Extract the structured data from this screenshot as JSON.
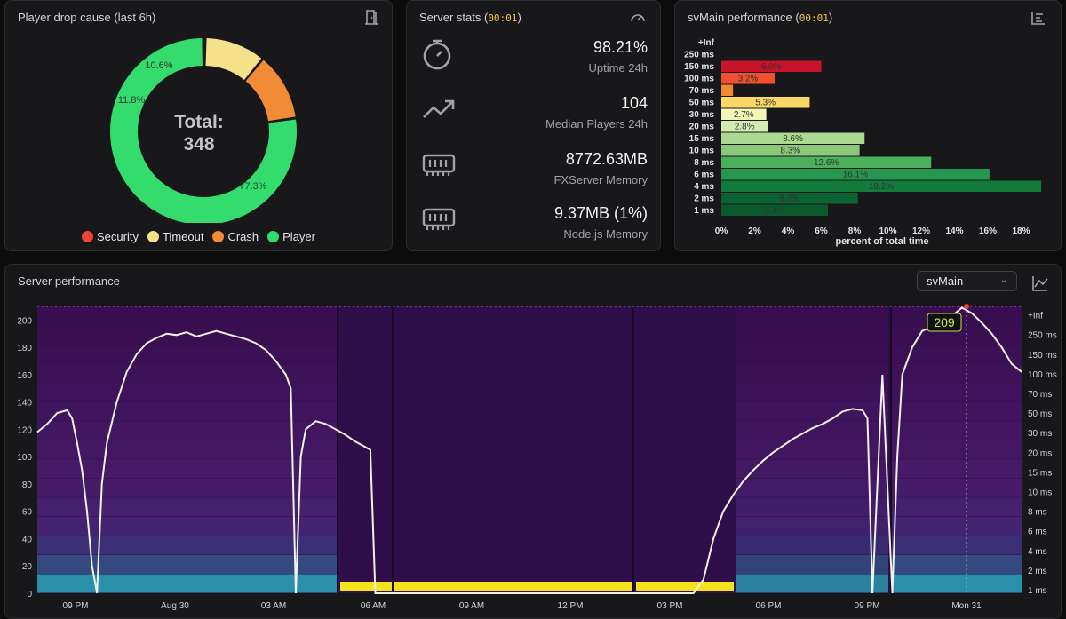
{
  "drop_card": {
    "title": "Player drop cause (last 6h)",
    "total_label": "Total:",
    "total_value": "348",
    "icon": "door-exit-icon",
    "slices": [
      {
        "name": "Security",
        "value": 0.3,
        "label": "",
        "color": "#ef4434"
      },
      {
        "name": "Timeout",
        "value": 10.6,
        "label": "10.6%",
        "color": "#f4e189"
      },
      {
        "name": "Crash",
        "value": 11.8,
        "label": "11.8%",
        "color": "#f28b35"
      },
      {
        "name": "Player",
        "value": 77.3,
        "label": "77.3%",
        "color": "#34dc6e"
      }
    ]
  },
  "stats_card": {
    "title": "Server stats",
    "timer": "00:01",
    "icon": "gauge-icon",
    "items": [
      {
        "value": "98.21%",
        "label": "Uptime 24h",
        "icon": "stopwatch-icon"
      },
      {
        "value": "104",
        "label": "Median Players 24h",
        "icon": "trending-up-icon"
      },
      {
        "value": "8772.63MB",
        "label": "FXServer Memory",
        "icon": "memory-chip-icon"
      },
      {
        "value": "9.37MB (1%)",
        "label": "Node.js Memory",
        "icon": "memory-chip-icon"
      }
    ]
  },
  "perf_card": {
    "title": "svMain performance",
    "timer": "00:01",
    "icon": "bar-chart-icon"
  },
  "server_perf_card": {
    "title": "Server performance",
    "select_value": "svMain",
    "icon": "line-chart-icon",
    "tooltip_value": "209",
    "x_ticks": [
      "09 PM",
      "Aug 30",
      "03 AM",
      "06 AM",
      "09 AM",
      "12 PM",
      "03 PM",
      "06 PM",
      "09 PM",
      "Mon 31"
    ],
    "y_ticks": [
      "0",
      "20",
      "40",
      "60",
      "80",
      "100",
      "120",
      "140",
      "160",
      "180",
      "200"
    ],
    "y_right_ticks": [
      "1 ms",
      "2 ms",
      "4 ms",
      "6 ms",
      "8 ms",
      "10 ms",
      "15 ms",
      "20 ms",
      "30 ms",
      "50 ms",
      "70 ms",
      "100 ms",
      "150 ms",
      "250 ms",
      "+Inf"
    ]
  },
  "chart_data": [
    {
      "type": "bar",
      "orientation": "horizontal",
      "categories": [
        "+Inf",
        "250 ms",
        "150 ms",
        "100 ms",
        "70 ms",
        "50 ms",
        "30 ms",
        "20 ms",
        "15 ms",
        "10 ms",
        "8 ms",
        "6 ms",
        "4 ms",
        "2 ms",
        "1 ms"
      ],
      "values": [
        0,
        0,
        6.0,
        3.2,
        0.7,
        5.3,
        2.7,
        2.8,
        8.6,
        8.3,
        12.6,
        16.1,
        19.2,
        8.2,
        6.4
      ],
      "value_labels": [
        "",
        "",
        "6.0%",
        "3.2%",
        "",
        "5.3%",
        "2.7%",
        "2.8%",
        "8.6%",
        "8.3%",
        "12.6%",
        "16.1%",
        "19.2%",
        "8.2%",
        "6.4%"
      ],
      "colors": [
        "#a50026",
        "#c0181d",
        "#c8142a",
        "#f0502b",
        "#f38a33",
        "#fbd766",
        "#f3f7b6",
        "#d4ecb0",
        "#acd991",
        "#8ac878",
        "#4bb05b",
        "#26974e",
        "#127a3b",
        "#0b6232",
        "#0b5a2c"
      ],
      "xlabel": "percent of total time",
      "x_ticks": [
        "0%",
        "2%",
        "4%",
        "6%",
        "8%",
        "10%",
        "12%",
        "14%",
        "16%",
        "18%"
      ],
      "xlim": [
        0,
        19.2
      ]
    },
    {
      "type": "line",
      "name": "players",
      "ylim": [
        0,
        210
      ],
      "points": [
        [
          0,
          118
        ],
        [
          1,
          124
        ],
        [
          2,
          132
        ],
        [
          3,
          134
        ],
        [
          3.5,
          128
        ],
        [
          4,
          110
        ],
        [
          4.5,
          90
        ],
        [
          5,
          60
        ],
        [
          5.5,
          20
        ],
        [
          6,
          0
        ],
        [
          6.5,
          80
        ],
        [
          7,
          110
        ],
        [
          8,
          140
        ],
        [
          9,
          162
        ],
        [
          10,
          175
        ],
        [
          11,
          183
        ],
        [
          12,
          187
        ],
        [
          13,
          190
        ],
        [
          14,
          189
        ],
        [
          15,
          191
        ],
        [
          16,
          188
        ],
        [
          17,
          190
        ],
        [
          18,
          192
        ],
        [
          19,
          190
        ],
        [
          20,
          188
        ],
        [
          21,
          186
        ],
        [
          22,
          183
        ],
        [
          23,
          178
        ],
        [
          24,
          170
        ],
        [
          25,
          160
        ],
        [
          25.5,
          150
        ],
        [
          26,
          0
        ],
        [
          26.5,
          100
        ],
        [
          27,
          120
        ],
        [
          28,
          126
        ],
        [
          29,
          124
        ],
        [
          30,
          120
        ],
        [
          31,
          116
        ],
        [
          32,
          111
        ],
        [
          33,
          107
        ],
        [
          33.5,
          105
        ],
        [
          34,
          0
        ],
        [
          64,
          0
        ],
        [
          66,
          0
        ],
        [
          67,
          10
        ],
        [
          68,
          40
        ],
        [
          69,
          60
        ],
        [
          70,
          72
        ],
        [
          71,
          82
        ],
        [
          72,
          90
        ],
        [
          73,
          97
        ],
        [
          74,
          103
        ],
        [
          75,
          108
        ],
        [
          76,
          113
        ],
        [
          77,
          117
        ],
        [
          78,
          121
        ],
        [
          79,
          124
        ],
        [
          80,
          128
        ],
        [
          81,
          133
        ],
        [
          82,
          135
        ],
        [
          83,
          134
        ],
        [
          83.5,
          128
        ],
        [
          84,
          0
        ],
        [
          85,
          160
        ],
        [
          86,
          0
        ],
        [
          86.5,
          100
        ],
        [
          87,
          160
        ],
        [
          88,
          180
        ],
        [
          89,
          192
        ],
        [
          90,
          195
        ],
        [
          91,
          198
        ],
        [
          92,
          203
        ],
        [
          93,
          209
        ],
        [
          94,
          205
        ],
        [
          95,
          198
        ],
        [
          96,
          190
        ],
        [
          97,
          180
        ],
        [
          98,
          168
        ],
        [
          99,
          162
        ]
      ]
    }
  ]
}
